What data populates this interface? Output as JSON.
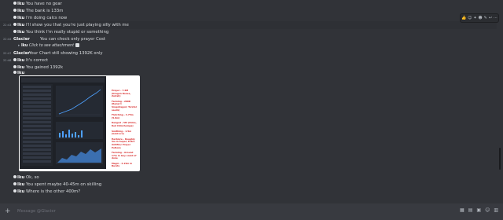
{
  "colors": {
    "background": "#313338",
    "composer": "#383a40",
    "annotation_red": "#d62828"
  },
  "messages": [
    {
      "time": "",
      "author": "Iku",
      "text": "You have no gear"
    },
    {
      "time": "",
      "author": "Iku",
      "text": "The bank is 133m"
    },
    {
      "time": "",
      "author": "Iku",
      "text": "I'm doing calcs now"
    },
    {
      "time": "22:43",
      "author": "Iku",
      "text": "I'll show you that you're just playing silly with me"
    },
    {
      "time": "",
      "author": "Iku",
      "text": "You think I'm really stupid or something"
    },
    {
      "time": "22:44",
      "author": "Glacier",
      "text": "You can check only prayer Cost"
    },
    {
      "time": "",
      "author": "",
      "reply_author": "Iku",
      "reply_text": "Click to see attachment"
    },
    {
      "time": "22:47",
      "author": "Glacier",
      "text": "Your Chart still showing 1392K only"
    },
    {
      "time": "22:48",
      "author": "Iku",
      "text": "It's correct"
    },
    {
      "time": "",
      "author": "Iku",
      "text": "You gained 1392k"
    },
    {
      "time": "",
      "author": "Iku",
      "text": ""
    },
    {
      "time": "",
      "author": "Iku",
      "text": "Ok, so"
    },
    {
      "time": "",
      "author": "Iku",
      "text": "You spent maybe 40-45m on skilling"
    },
    {
      "time": "",
      "author": "Iku",
      "text": "Where is the other 400m?"
    }
  ],
  "toolbar_icons": [
    "thumbs-up-icon",
    "emoji-icon",
    "reaction-icon",
    "add-reaction-icon",
    "edit-icon",
    "reply-icon",
    "more-icon"
  ],
  "attachment_notes": [
    "Prayer - 7.6M (Dragon Bones, Zulrah)",
    "Farming - 200K (Ranarr/ Snapdragon/ Torstol seeds)",
    "Fletching - 4.75m (5.8m)",
    "Ranged - 5M (Chins, Red Chinchompa)",
    "Smithing - 1.5m (Gold ore)",
    "Herblore - Roughly 5m in Super/ Extra Antifire/ Prayer Potions",
    "Farming - Around 17m in Guy could of done",
    "Magic - 4.15m in Bursts"
  ],
  "composer": {
    "placeholder": "Message @Glacier"
  }
}
